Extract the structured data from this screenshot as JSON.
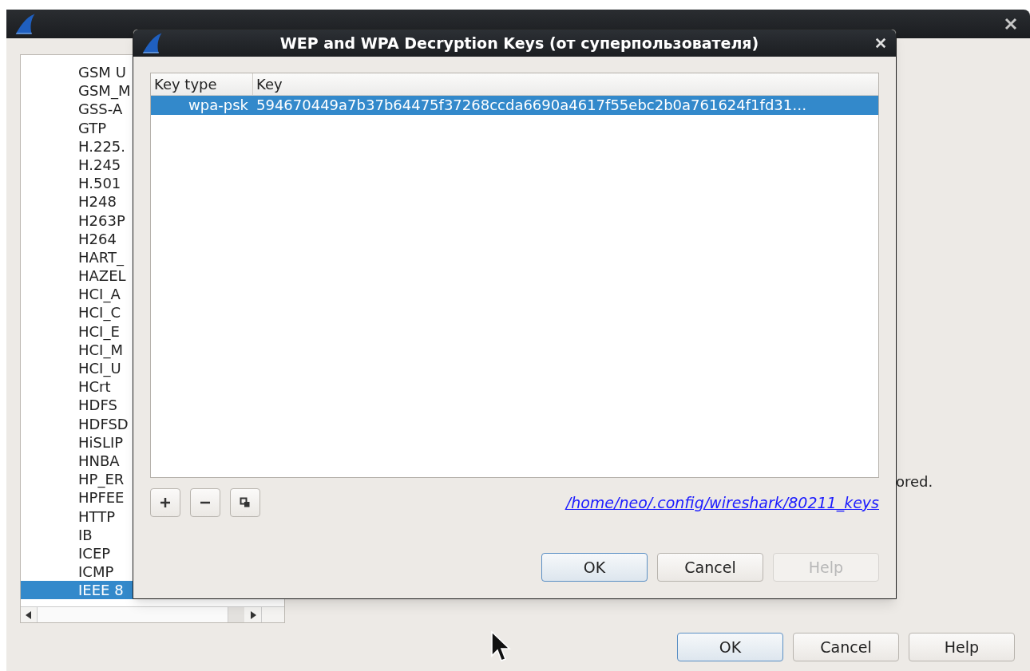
{
  "main_window": {
    "protocols": [
      {
        "label": "GSM U",
        "selected": false
      },
      {
        "label": "GSM_M",
        "selected": false
      },
      {
        "label": "GSS-A",
        "selected": false
      },
      {
        "label": "GTP",
        "selected": false
      },
      {
        "label": "H.225.",
        "selected": false
      },
      {
        "label": "H.245",
        "selected": false
      },
      {
        "label": "H.501",
        "selected": false
      },
      {
        "label": "H248",
        "selected": false
      },
      {
        "label": "H263P",
        "selected": false
      },
      {
        "label": "H264",
        "selected": false
      },
      {
        "label": "HART_",
        "selected": false
      },
      {
        "label": "HAZEL",
        "selected": false
      },
      {
        "label": "HCI_A",
        "selected": false
      },
      {
        "label": "HCI_C",
        "selected": false
      },
      {
        "label": "HCI_E",
        "selected": false
      },
      {
        "label": "HCI_M",
        "selected": false
      },
      {
        "label": "HCI_U",
        "selected": false
      },
      {
        "label": "HCrt",
        "selected": false
      },
      {
        "label": "HDFS",
        "selected": false
      },
      {
        "label": "HDFSD",
        "selected": false
      },
      {
        "label": "HiSLIP",
        "selected": false
      },
      {
        "label": "HNBA",
        "selected": false
      },
      {
        "label": "HP_ER",
        "selected": false
      },
      {
        "label": "HPFEE",
        "selected": false
      },
      {
        "label": "HTTP",
        "selected": false
      },
      {
        "label": "IB",
        "selected": false
      },
      {
        "label": "ICEP",
        "selected": false
      },
      {
        "label": "ICMP",
        "selected": false
      },
      {
        "label": "IEEE 8",
        "selected": true
      }
    ],
    "partial_text": "ored.",
    "buttons": [
      {
        "label": "OK",
        "default": true
      },
      {
        "label": "Cancel",
        "default": false
      },
      {
        "label": "Help",
        "default": false
      }
    ]
  },
  "dialog": {
    "title": "WEP and WPA Decryption Keys (от суперпользователя)",
    "table": {
      "columns": [
        "Key type",
        "Key"
      ],
      "rows": [
        {
          "key_type": "wpa-psk",
          "key": "594670449a7b37b64475f37268ccda6690a4617f55ebc2b0a761624f1fd31…",
          "selected": true
        }
      ]
    },
    "link": "/home/neo/.config/wireshark/80211_keys",
    "buttons": [
      {
        "label": "OK",
        "default": true,
        "disabled": false
      },
      {
        "label": "Cancel",
        "default": false,
        "disabled": false
      },
      {
        "label": "Help",
        "default": false,
        "disabled": true
      }
    ]
  }
}
